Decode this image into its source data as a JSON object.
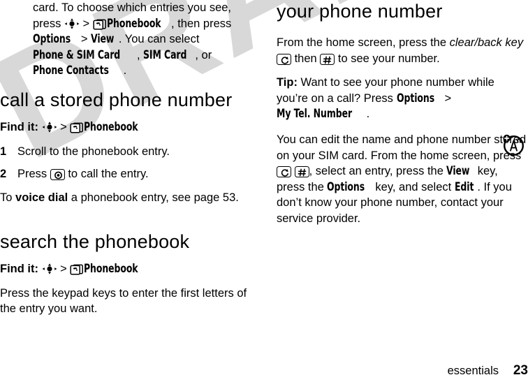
{
  "document": {
    "watermark": "DRAFT",
    "footer": {
      "chapter": "essentials",
      "page_number": "23"
    }
  },
  "left_column": {
    "intro_note": {
      "seg1": "card. To choose which entries you see, press ",
      "icon1": "nav-select-key-icon",
      "seg2": " > ",
      "icon2": "phonebook-icon",
      "ui1": "Phonebook",
      "seg3": ", then press ",
      "ui2": "Options",
      "seg4": " > ",
      "ui3": "View",
      "seg5": ". You can select ",
      "ui4": "Phone & SIM Card",
      "seg6": ", ",
      "ui5": "SIM Card",
      "seg7": ", or ",
      "ui6": "Phone Contacts",
      "seg8": "."
    },
    "section1": {
      "heading": "call a stored phone number",
      "findit": {
        "label": "Find it:",
        "icon1": "nav-select-key-icon",
        "sep": " > ",
        "icon2": "phonebook-icon",
        "target": "Phonebook"
      },
      "steps": [
        {
          "num": "1",
          "seg1": "Scroll to the phonebook entry.",
          "icon": "",
          "seg2": ""
        },
        {
          "num": "2",
          "seg1": "Press ",
          "icon": "send-call-key-icon",
          "seg2": " to call the entry."
        }
      ],
      "closing": {
        "seg1": "To ",
        "bold1": "voice dial",
        "seg2": " a phonebook entry, see page 53."
      }
    },
    "section2": {
      "heading": "search the phonebook",
      "findit": {
        "label": "Find it:",
        "icon1": "nav-select-key-icon",
        "sep": " > ",
        "icon2": "phonebook-icon",
        "target": "Phonebook"
      },
      "paragraph": "Press the keypad keys to enter the first letters of the entry you want."
    }
  },
  "right_column": {
    "heading": "your phone number",
    "para1": {
      "seg1": "From the home screen, press the ",
      "ital1": "clear/back key",
      "seg2": " ",
      "icon1": "clear-back-key-icon",
      "seg3": " then ",
      "icon2": "pound-key-icon",
      "seg4": " to see your number."
    },
    "tip": {
      "label": "Tip:",
      "seg1": " Want to see your phone number while you’re on a call? Press ",
      "ui1": "Options",
      "seg2": " > ",
      "ui2": "My Tel. Number",
      "seg3": "."
    },
    "para2": {
      "seg1": "You can edit the name and phone number stored on your SIM card. From the home screen, press ",
      "icon1": "clear-back-key-icon",
      "seg2": " ",
      "icon2": "pound-key-icon",
      "seg3": ", select an entry, press the ",
      "ui1": "View",
      "seg4": " key, press the ",
      "ui2": "Options",
      "seg5": " key, and select ",
      "ui3": "Edit",
      "seg6": ". If you don’t know your phone number, contact your service provider."
    },
    "margin_icon": "network-antenna-badge-icon"
  },
  "colors": {
    "text": "#000000",
    "watermark": "#d8d8d8",
    "background": "#ffffff"
  }
}
